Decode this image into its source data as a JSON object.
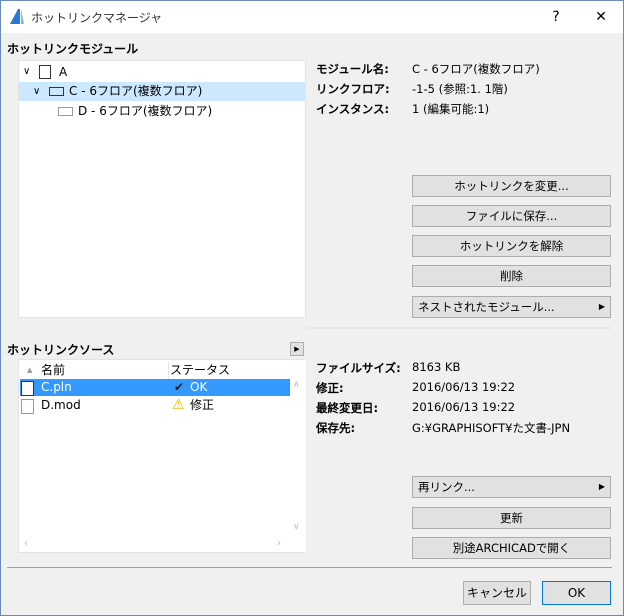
{
  "window": {
    "title": "ホットリンクマネージャ",
    "help": "?",
    "close": "✕"
  },
  "modules": {
    "section_label": "ホットリンクモジュール",
    "tree": [
      {
        "label": "A"
      },
      {
        "label": "C - 6フロア(複数フロア)"
      },
      {
        "label": "D - 6フロア(複数フロア)"
      }
    ],
    "info": [
      {
        "label": "モジュール名:",
        "value": "C - 6フロア(複数フロア)"
      },
      {
        "label": "リンクフロア:",
        "value": "-1-5 (参照:1. 1階)"
      },
      {
        "label": "インスタンス:",
        "value": "1 (編集可能:1)"
      }
    ],
    "buttons": {
      "change": "ホットリンクを変更...",
      "save": "ファイルに保存...",
      "break": "ホットリンクを解除",
      "delete": "削除",
      "nested": "ネストされたモジュール..."
    }
  },
  "sources": {
    "section_label": "ホットリンクソース",
    "columns": {
      "name": "名前",
      "status": "ステータス"
    },
    "rows": [
      {
        "name": "C.pln",
        "status": "OK"
      },
      {
        "name": "D.mod",
        "status": "修正"
      }
    ],
    "info": [
      {
        "label": "ファイルサイズ:",
        "value": "8163 KB"
      },
      {
        "label": "修正:",
        "value": "2016/06/13 19:22"
      },
      {
        "label": "最終変更日:",
        "value": "2016/06/13 19:22"
      },
      {
        "label": "保存先:",
        "value": "G:¥GRAPHISOFT¥た文書-JPN"
      }
    ],
    "buttons": {
      "relink": "再リンク...",
      "update": "更新",
      "open": "別途ARCHICADで開く"
    }
  },
  "footer": {
    "cancel": "キャンセル",
    "ok": "OK"
  },
  "colors": {
    "selected": "#3399ff",
    "tree_selected": "#cce8ff"
  }
}
